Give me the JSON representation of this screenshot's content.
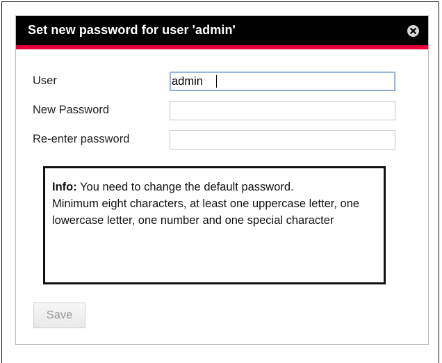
{
  "dialog": {
    "title": "Set new password for user 'admin'",
    "close_icon": "close-circle-icon"
  },
  "form": {
    "user": {
      "label": "User",
      "value": "admin"
    },
    "new_password": {
      "label": "New Password",
      "value": ""
    },
    "reenter_password": {
      "label": "Re-enter password",
      "value": ""
    }
  },
  "info": {
    "prefix": "Info:",
    "line1": " You need to change the default password.",
    "line2": "Minimum eight characters, at least one uppercase letter, one lowercase letter, one number and one special character"
  },
  "buttons": {
    "save_label": "Save",
    "save_enabled": false
  },
  "colors": {
    "titlebar": "#000000",
    "accent": "#e6003c",
    "focus_border": "#7a9cc6"
  }
}
